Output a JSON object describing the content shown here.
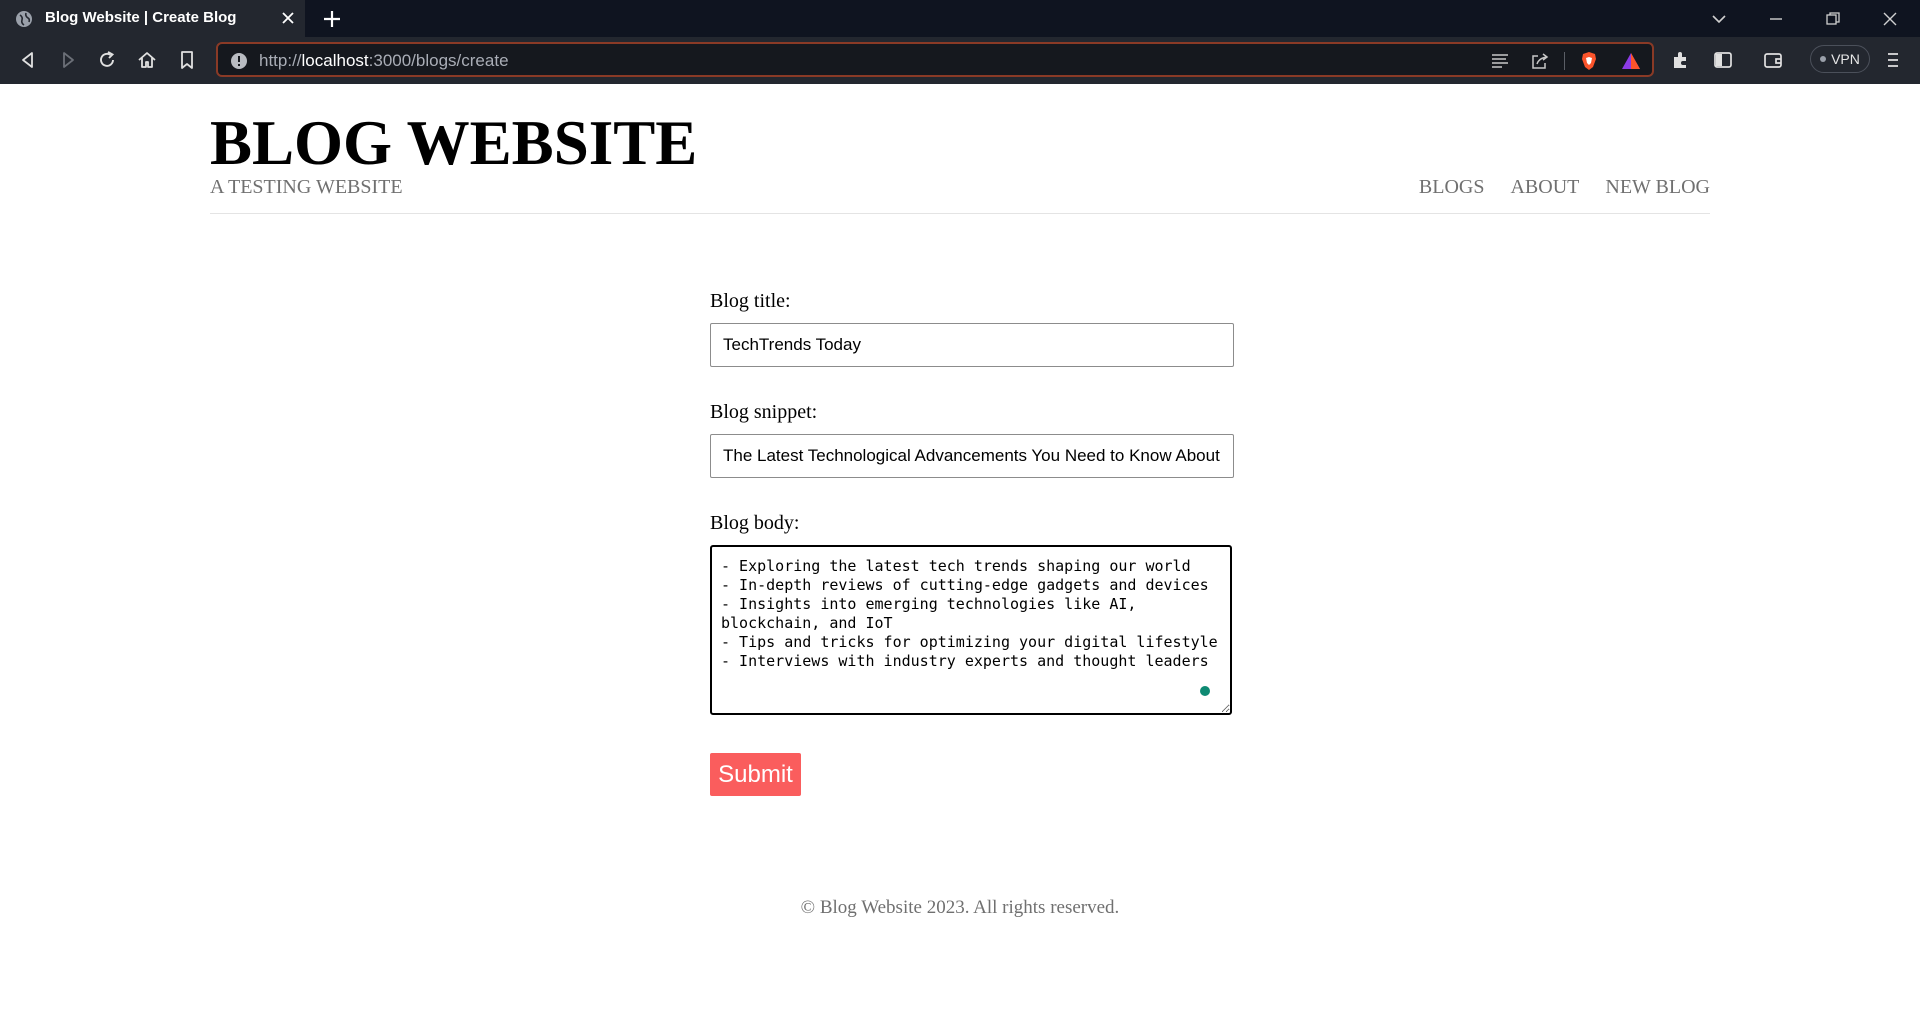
{
  "browser": {
    "tab_title": "Blog Website | Create Blog",
    "url_scheme": "http://",
    "url_host": "localhost",
    "url_path": ":3000/blogs/create",
    "vpn_label": "VPN",
    "accent_color": "#fb542b"
  },
  "site": {
    "title": "BLOG WEBSITE",
    "subtitle": "A TESTING WEBSITE",
    "nav": [
      {
        "label": "BLOGS"
      },
      {
        "label": "ABOUT"
      },
      {
        "label": "NEW BLOG"
      }
    ]
  },
  "form": {
    "title_label": "Blog title:",
    "title_value": "TechTrends Today",
    "snippet_label": "Blog snippet:",
    "snippet_value": "The Latest Technological Advancements You Need to Know About",
    "body_label": "Blog body:",
    "body_value": "- Exploring the latest tech trends shaping our world\n- In-depth reviews of cutting-edge gadgets and devices\n- Insights into emerging technologies like AI, blockchain, and IoT\n- Tips and tricks for optimizing your digital lifestyle\n- Interviews with industry experts and thought leaders",
    "submit_label": "Submit",
    "submit_color": "#fa5d5d"
  },
  "footer": {
    "text": "© Blog Website 2023. All rights reserved."
  }
}
